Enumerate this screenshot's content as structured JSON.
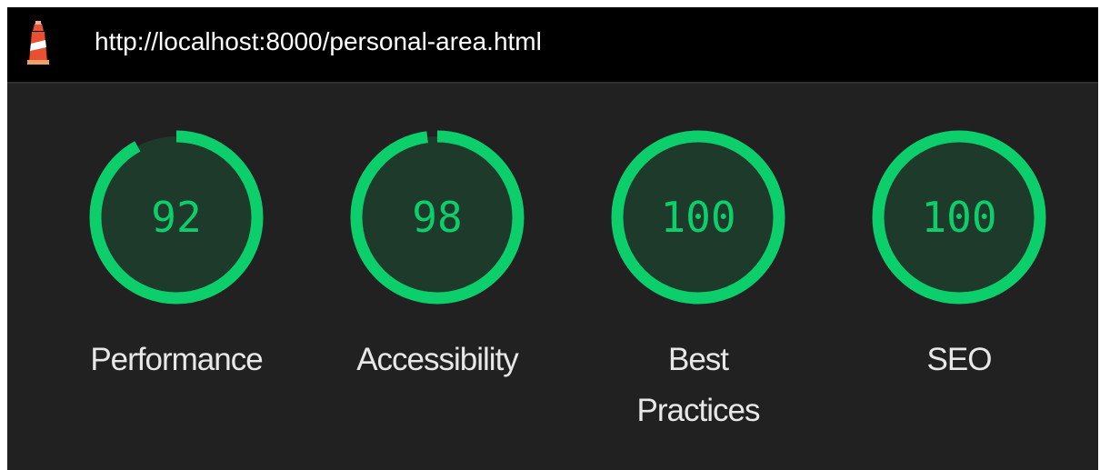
{
  "url_bar": {
    "url": "http://localhost:8000/personal-area.html",
    "icon": "lighthouse-icon"
  },
  "colors": {
    "pass": "#0cce6b",
    "pass_fill": "#1d3a2a",
    "background": "#212121",
    "bar": "#000000"
  },
  "gauges": [
    {
      "id": "performance",
      "label": "Performance",
      "score": "92",
      "fraction": 0.92
    },
    {
      "id": "accessibility",
      "label": "Accessibility",
      "score": "98",
      "fraction": 0.98
    },
    {
      "id": "best-practices",
      "label": "Best\nPractices",
      "score": "100",
      "fraction": 1.0
    },
    {
      "id": "seo",
      "label": "SEO",
      "score": "100",
      "fraction": 1.0
    }
  ]
}
